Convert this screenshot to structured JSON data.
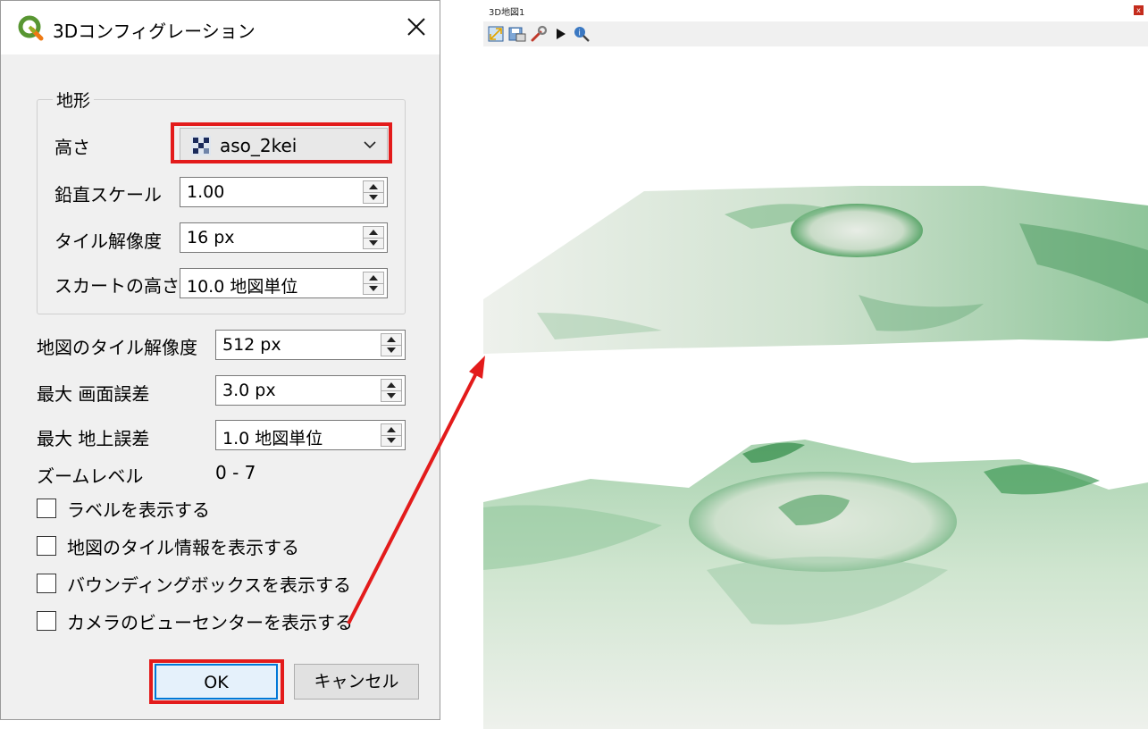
{
  "dialog": {
    "title": "3Dコンフィグレーション",
    "terrain_group": {
      "title": "地形",
      "elevation_label": "高さ",
      "elevation_value": "aso_2kei",
      "vertical_scale_label": "鉛直スケール",
      "vertical_scale_value": "1.00",
      "tile_resolution_label": "タイル解像度",
      "tile_resolution_value": "16 px",
      "skirt_height_label": "スカートの高さ",
      "skirt_height_value": "10.0 地図単位"
    },
    "map_tile_resolution_label": "地図のタイル解像度",
    "map_tile_resolution_value": "512 px",
    "max_screen_error_label": "最大 画面誤差",
    "max_screen_error_value": "3.0 px",
    "max_ground_error_label": "最大 地上誤差",
    "max_ground_error_value": "1.0 地図単位",
    "zoom_levels_label": "ズームレベル",
    "zoom_levels_value": "0 - 7",
    "checkboxes": [
      {
        "label": "ラベルを表示する",
        "checked": false
      },
      {
        "label": "地図のタイル情報を表示する",
        "checked": false
      },
      {
        "label": "バウンディングボックスを表示する",
        "checked": false
      },
      {
        "label": "カメラのビューセンターを表示する",
        "checked": false
      }
    ],
    "ok_label": "OK",
    "cancel_label": "キャンセル"
  },
  "map_window": {
    "title": "3D地図1",
    "close_glyph": "x",
    "toolbar_icons": [
      "zoom-full-icon",
      "save-image-icon",
      "configure-wrench-icon",
      "play-animation-icon",
      "identify-icon"
    ]
  },
  "colors": {
    "highlight": "#e31b1b",
    "terrain_green": "#3f9a55",
    "terrain_light": "#e6ece4"
  }
}
